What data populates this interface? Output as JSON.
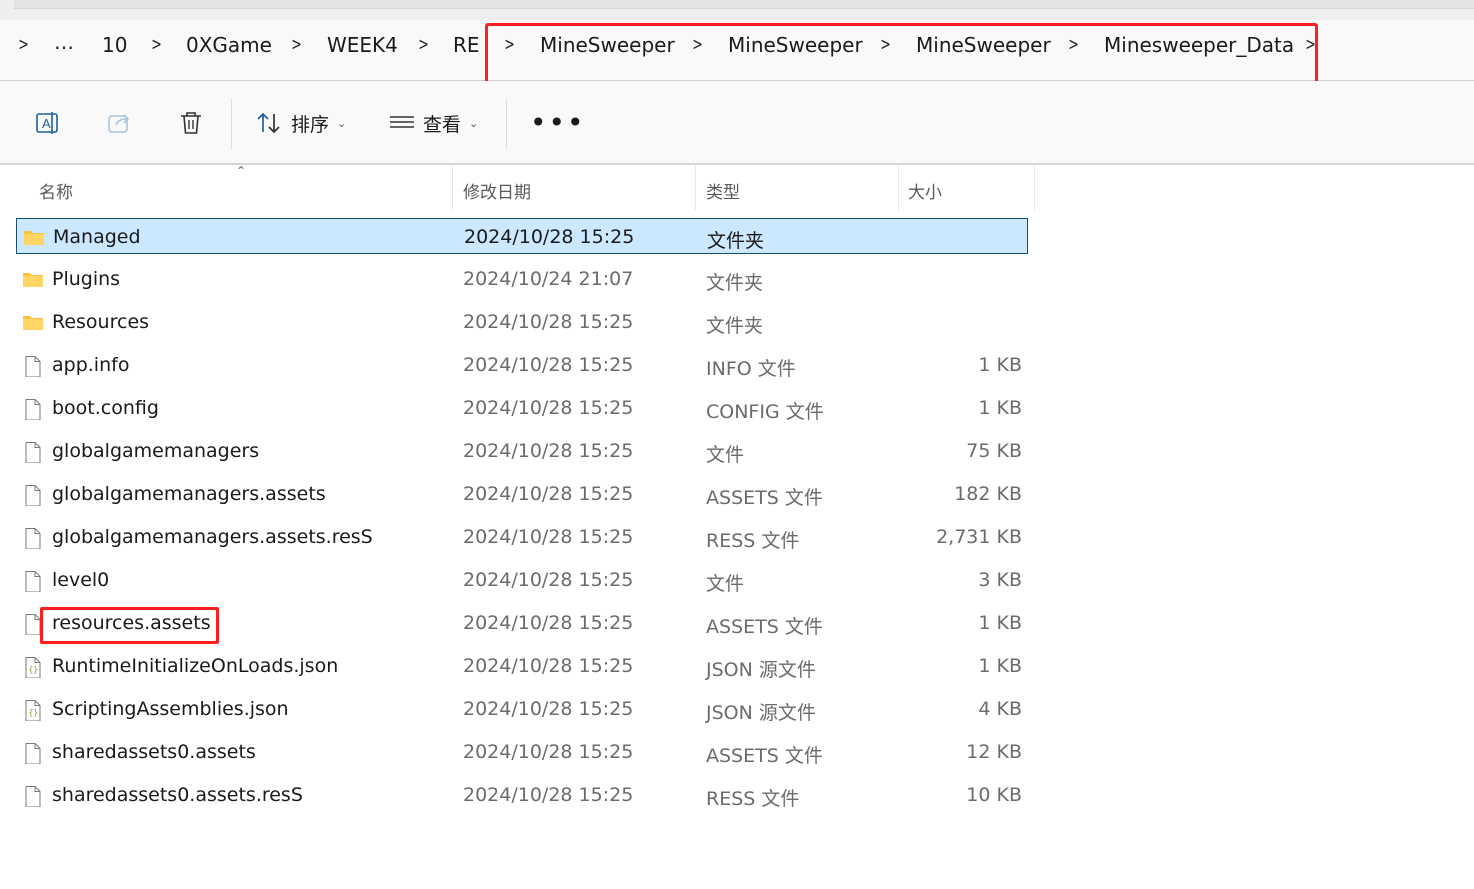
{
  "breadcrumb": {
    "overflow": "…",
    "items": [
      "10",
      "0XGame",
      "WEEK4",
      "RE",
      "MineSweeper",
      "MineSweeper",
      "MineSweeper",
      "Minesweeper_Data"
    ]
  },
  "toolbar": {
    "rename_icon": "rename-icon",
    "share_icon": "share-icon",
    "delete_icon": "trash-icon",
    "sort_label": "排序",
    "view_label": "查看",
    "more_icon": "more-icon"
  },
  "columns": {
    "name": "名称",
    "modified": "修改日期",
    "type": "类型",
    "size": "大小"
  },
  "files": [
    {
      "name": "Managed",
      "modified": "2024/10/28 15:25",
      "type": "文件夹",
      "size": "",
      "icon": "folder-icon",
      "selected": true
    },
    {
      "name": "Plugins",
      "modified": "2024/10/24 21:07",
      "type": "文件夹",
      "size": "",
      "icon": "folder-icon"
    },
    {
      "name": "Resources",
      "modified": "2024/10/28 15:25",
      "type": "文件夹",
      "size": "",
      "icon": "folder-icon"
    },
    {
      "name": "app.info",
      "modified": "2024/10/28 15:25",
      "type": "INFO 文件",
      "size": "1 KB",
      "icon": "file-icon"
    },
    {
      "name": "boot.config",
      "modified": "2024/10/28 15:25",
      "type": "CONFIG 文件",
      "size": "1 KB",
      "icon": "file-icon"
    },
    {
      "name": "globalgamemanagers",
      "modified": "2024/10/28 15:25",
      "type": "文件",
      "size": "75 KB",
      "icon": "file-icon"
    },
    {
      "name": "globalgamemanagers.assets",
      "modified": "2024/10/28 15:25",
      "type": "ASSETS 文件",
      "size": "182 KB",
      "icon": "file-icon"
    },
    {
      "name": "globalgamemanagers.assets.resS",
      "modified": "2024/10/28 15:25",
      "type": "RESS 文件",
      "size": "2,731 KB",
      "icon": "file-icon"
    },
    {
      "name": "level0",
      "modified": "2024/10/28 15:25",
      "type": "文件",
      "size": "3 KB",
      "icon": "file-icon"
    },
    {
      "name": "resources.assets",
      "modified": "2024/10/28 15:25",
      "type": "ASSETS 文件",
      "size": "1 KB",
      "icon": "file-icon"
    },
    {
      "name": "RuntimeInitializeOnLoads.json",
      "modified": "2024/10/28 15:25",
      "type": "JSON 源文件",
      "size": "1 KB",
      "icon": "json-file-icon"
    },
    {
      "name": "ScriptingAssemblies.json",
      "modified": "2024/10/28 15:25",
      "type": "JSON 源文件",
      "size": "4 KB",
      "icon": "json-file-icon"
    },
    {
      "name": "sharedassets0.assets",
      "modified": "2024/10/28 15:25",
      "type": "ASSETS 文件",
      "size": "12 KB",
      "icon": "file-icon"
    },
    {
      "name": "sharedassets0.assets.resS",
      "modified": "2024/10/28 15:25",
      "type": "RESS 文件",
      "size": "10 KB",
      "icon": "file-icon"
    }
  ],
  "colors": {
    "annotation": "#ff1f1f",
    "selection": "#cce8ff",
    "folder": "#f5c242"
  }
}
